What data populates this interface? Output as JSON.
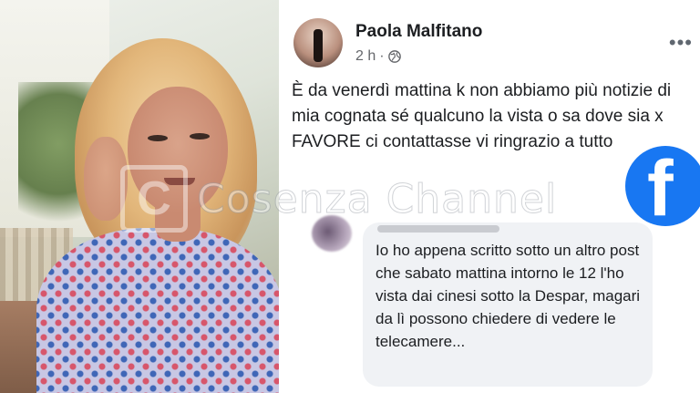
{
  "profile": {
    "name": "Paola Malfitano",
    "time": "2 h",
    "separator": "·",
    "privacy_icon": "globe-icon"
  },
  "post": {
    "text": "È da venerdì mattina k non abbiamo più notizie di mia cognata sé qualcuno la vista o sa dove sia x FAVORE ci contattasse vi ringrazio a tutto"
  },
  "menu": {
    "icon": "more-options-icon",
    "label": "•••"
  },
  "comment": {
    "text": "Io ho appena scritto sotto un altro post che sabato mattina intorno le 12 l'ho vista dai cinesi sotto la Despar, magari da lì possono chiedere di vedere le telecamere..."
  },
  "brand": {
    "logo_icon": "facebook-icon",
    "logo_letter": "f",
    "color": "#1877f2"
  },
  "watermark": {
    "text": "Cosenza Channel",
    "logo_letter": "C"
  },
  "colors": {
    "text_primary": "#1c1e21",
    "text_secondary": "#65676b",
    "bubble": "#f0f2f5"
  }
}
